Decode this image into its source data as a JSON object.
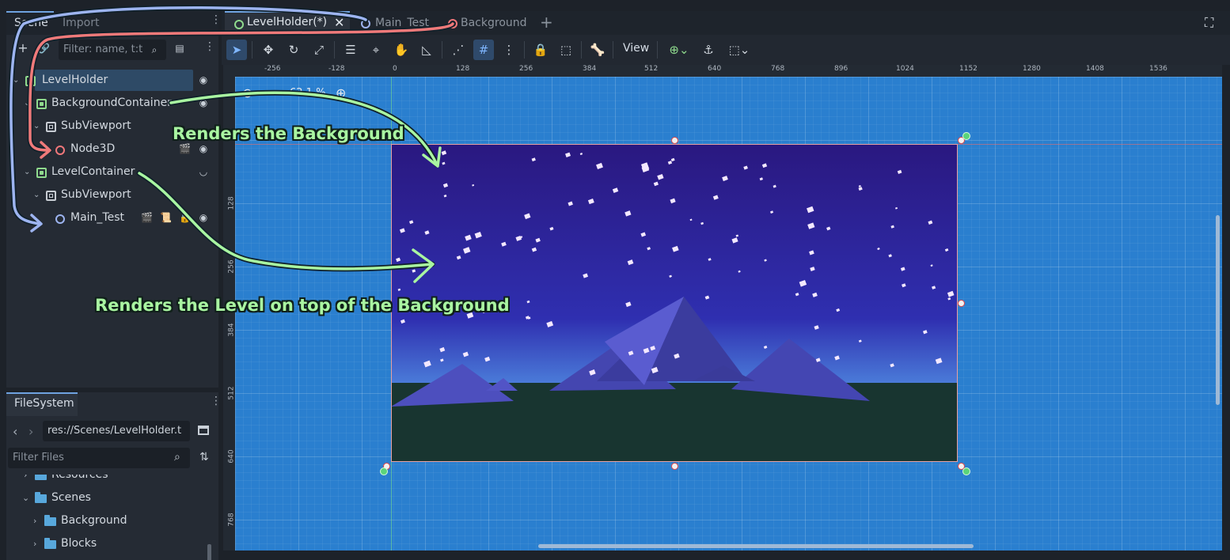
{
  "scene_dock": {
    "tabs": [
      {
        "label": "Scene"
      },
      {
        "label": "Import"
      }
    ],
    "filter_placeholder": "Filter: name, t:t",
    "tree": [
      {
        "label": "LevelHolder",
        "type": "control"
      },
      {
        "label": "BackgroundContainer",
        "type": "control"
      },
      {
        "label": "SubViewport",
        "type": "subviewport"
      },
      {
        "label": "Node3D",
        "type": "node3d"
      },
      {
        "label": "LevelContainer",
        "type": "control"
      },
      {
        "label": "SubViewport",
        "type": "subviewport"
      },
      {
        "label": "Main_Test",
        "type": "node2d"
      }
    ]
  },
  "filesystem": {
    "title": "FileSystem",
    "path": "res://Scenes/LevelHolder.t",
    "filter_placeholder": "Filter Files",
    "items": [
      {
        "label": "Resources"
      },
      {
        "label": "Scenes"
      },
      {
        "label": "Background"
      },
      {
        "label": "Blocks"
      }
    ]
  },
  "scene_tabs": [
    {
      "label": "LevelHolder(*)",
      "active": true
    },
    {
      "label": "Main_Test",
      "active": false
    },
    {
      "label": "Background",
      "active": false
    }
  ],
  "toolbar": {
    "view_label": "View"
  },
  "viewport": {
    "zoom_label": "62.1 %",
    "ruler_x": [
      "-256",
      "-128",
      "0",
      "128",
      "256",
      "384",
      "512",
      "640",
      "768",
      "896",
      "1024",
      "1152",
      "1280",
      "1408",
      "1536"
    ],
    "ruler_y": [
      "128",
      "256",
      "384",
      "512",
      "640",
      "768"
    ]
  },
  "annotations": {
    "background_text": "Renders the Background",
    "level_text": "Renders the Level on top of the Background"
  },
  "colors": {
    "accent": "#6fa3e0",
    "control_node": "#8fda8d",
    "node3d": "#f0777a",
    "node2d": "#9db4f0",
    "arrow_green": "#a9f5a1",
    "arrow_red": "#f07a7a",
    "arrow_blue": "#9db4f0"
  }
}
